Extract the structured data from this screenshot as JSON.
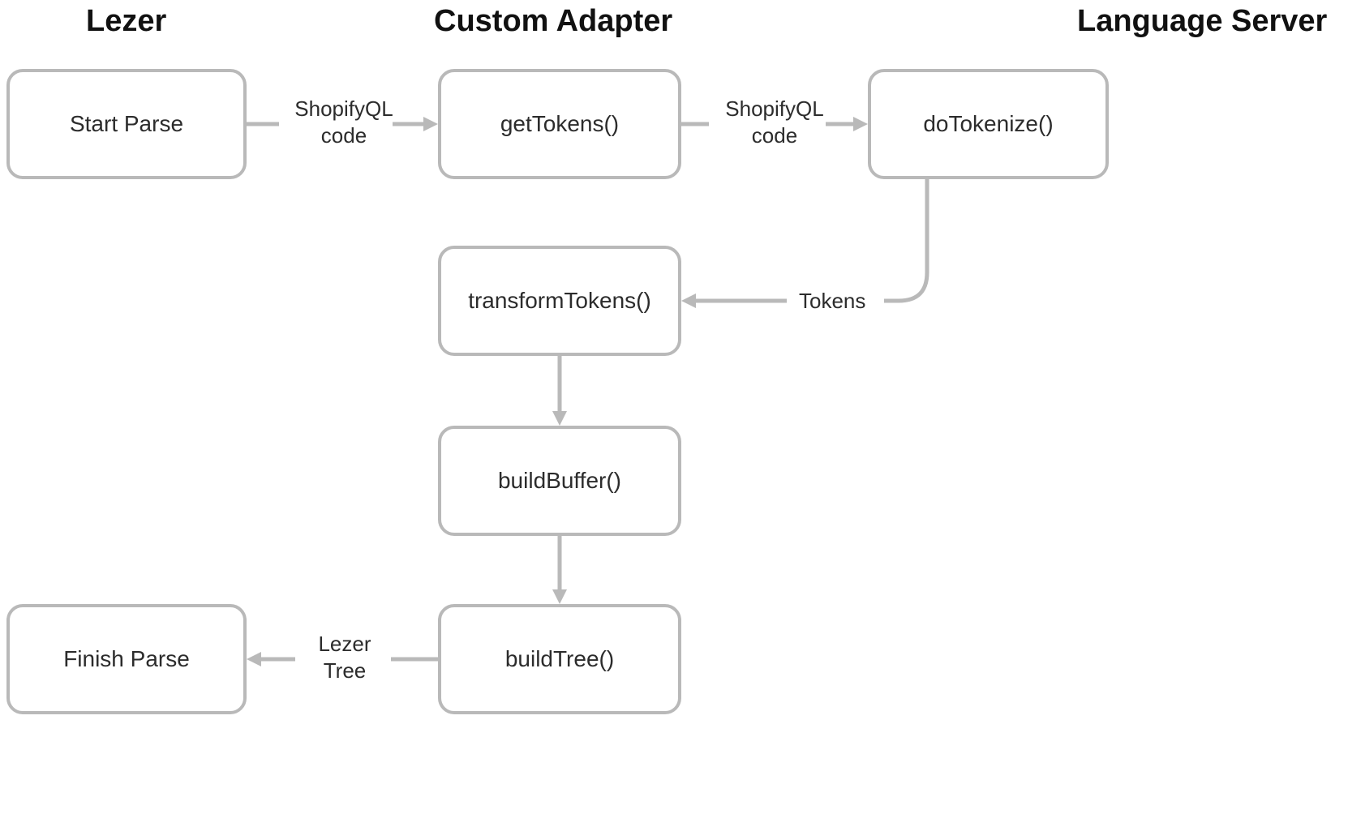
{
  "columns": {
    "lezer": "Lezer",
    "adapter": "Custom Adapter",
    "server": "Language Server"
  },
  "nodes": {
    "startParse": "Start Parse",
    "getTokens": "getTokens()",
    "doTokenize": "doTokenize()",
    "transformTokens": "transformTokens()",
    "buildBuffer": "buildBuffer()",
    "buildTree": "buildTree()",
    "finishParse": "Finish Parse"
  },
  "edges": {
    "shopifyql1": "ShopifyQL\ncode",
    "shopifyql2": "ShopifyQL\ncode",
    "tokens": "Tokens",
    "lezerTree": "Lezer\nTree"
  }
}
